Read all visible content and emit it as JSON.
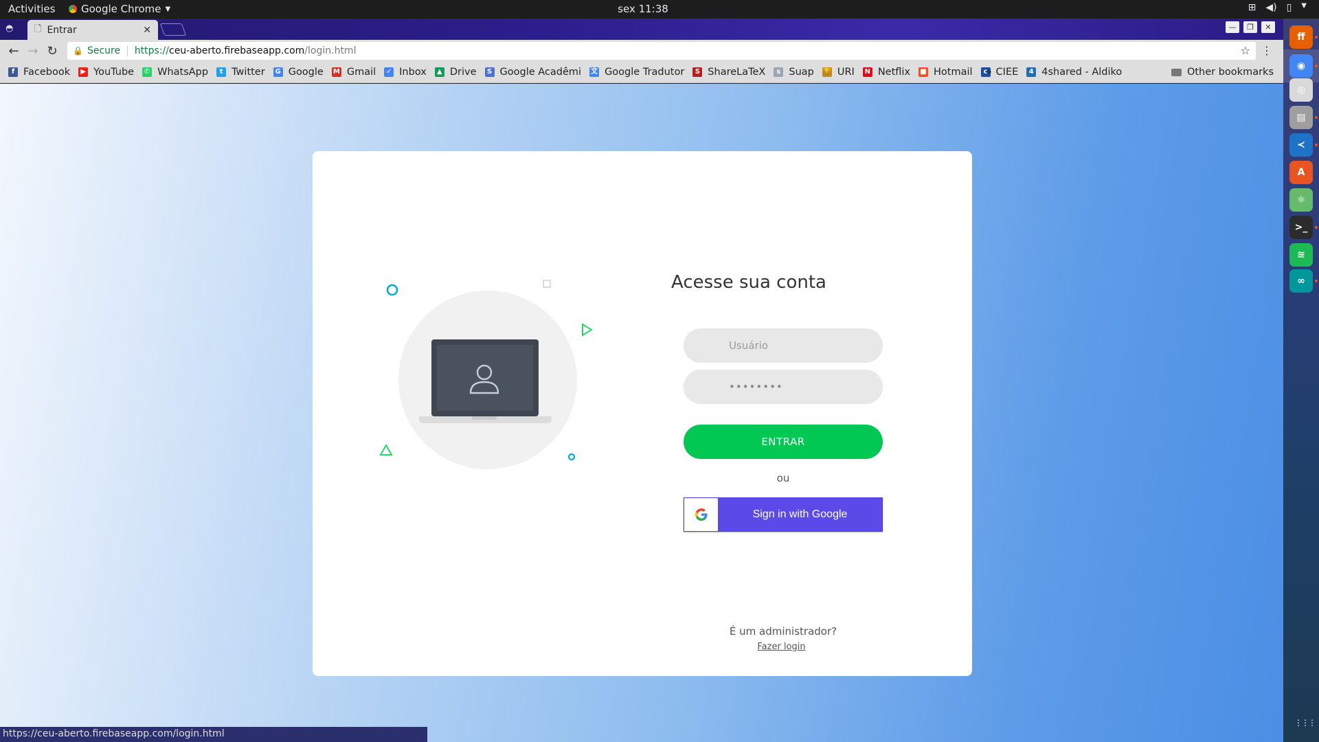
{
  "topbar": {
    "activities": "Activities",
    "app_name": "Google Chrome",
    "clock": "sex 11:38"
  },
  "tab": {
    "title": "Entrar"
  },
  "omnibox": {
    "secure_label": "Secure",
    "url_scheme": "https://",
    "url_host": "ceu-aberto.firebaseapp.com",
    "url_path": "/login.html"
  },
  "bookmarks": [
    {
      "label": "Facebook",
      "icon": "facebook-icon",
      "color": "#3b5998",
      "glyph": "f"
    },
    {
      "label": "YouTube",
      "icon": "youtube-icon",
      "color": "#e62117",
      "glyph": "▶"
    },
    {
      "label": "WhatsApp",
      "icon": "whatsapp-icon",
      "color": "#25d366",
      "glyph": "✆"
    },
    {
      "label": "Twitter",
      "icon": "twitter-icon",
      "color": "#1da1f2",
      "glyph": "t"
    },
    {
      "label": "Google",
      "icon": "google-icon",
      "color": "#4285f4",
      "glyph": "G"
    },
    {
      "label": "Gmail",
      "icon": "gmail-icon",
      "color": "#d93025",
      "glyph": "M"
    },
    {
      "label": "Inbox",
      "icon": "inbox-icon",
      "color": "#4285f4",
      "glyph": "✓"
    },
    {
      "label": "Drive",
      "icon": "drive-icon",
      "color": "#0f9d58",
      "glyph": "▲"
    },
    {
      "label": "Google Acadêmi",
      "icon": "scholar-icon",
      "color": "#4d6fd8",
      "glyph": "S"
    },
    {
      "label": "Google Tradutor",
      "icon": "translate-icon",
      "color": "#4285f4",
      "glyph": "文"
    },
    {
      "label": "ShareLaTeX",
      "icon": "sharelatex-icon",
      "color": "#b5201f",
      "glyph": "S"
    },
    {
      "label": "Suap",
      "icon": "suap-icon",
      "color": "#9aa6b2",
      "glyph": "s"
    },
    {
      "label": "URI",
      "icon": "uri-icon",
      "color": "#c58b10",
      "glyph": "🏆"
    },
    {
      "label": "Netflix",
      "icon": "netflix-icon",
      "color": "#e50914",
      "glyph": "N"
    },
    {
      "label": "Hotmail",
      "icon": "hotmail-icon",
      "color": "#f25022",
      "glyph": "■"
    },
    {
      "label": "CIEE",
      "icon": "ciee-icon",
      "color": "#1a4fa3",
      "glyph": "c"
    },
    {
      "label": "4shared - Aldiko",
      "icon": "4shared-icon",
      "color": "#1d6fb8",
      "glyph": "4"
    }
  ],
  "bookmarks_more": "»",
  "other_bookmarks": "Other bookmarks",
  "login": {
    "title": "Acesse sua conta",
    "username_placeholder": "Usuário",
    "password_value": "••••••••",
    "submit_label": "ENTRAR",
    "separator": "ou",
    "google_label": "Sign in with Google",
    "admin_question": "É um administrador?",
    "admin_link": "Fazer login"
  },
  "status_url": "https://ceu-aberto.firebaseapp.com/login.html",
  "colors": {
    "primary_button": "#00c853",
    "google_button": "#5b4ae8",
    "accent_cyan": "#00a8d6",
    "accent_green": "#2ed36b"
  },
  "dock": [
    {
      "name": "firefox-icon",
      "color": "#e66000",
      "glyph": "ff"
    },
    {
      "name": "chrome-icon",
      "color": "#4285f4",
      "glyph": "◉"
    },
    {
      "name": "rhythmbox-icon",
      "color": "#d9d9d9",
      "glyph": "◎"
    },
    {
      "name": "files-icon",
      "color": "#9e9e9e",
      "glyph": "▤"
    },
    {
      "name": "vscode-icon",
      "color": "#1e73c9",
      "glyph": "≺"
    },
    {
      "name": "software-center-icon",
      "color": "#e95420",
      "glyph": "A"
    },
    {
      "name": "atom-icon",
      "color": "#66bb6a",
      "glyph": "⚛"
    },
    {
      "name": "terminal-icon",
      "color": "#2c2c2c",
      "glyph": ">_"
    },
    {
      "name": "spotify-icon",
      "color": "#1db954",
      "glyph": "≋"
    },
    {
      "name": "arduino-icon",
      "color": "#00979c",
      "glyph": "∞"
    }
  ]
}
